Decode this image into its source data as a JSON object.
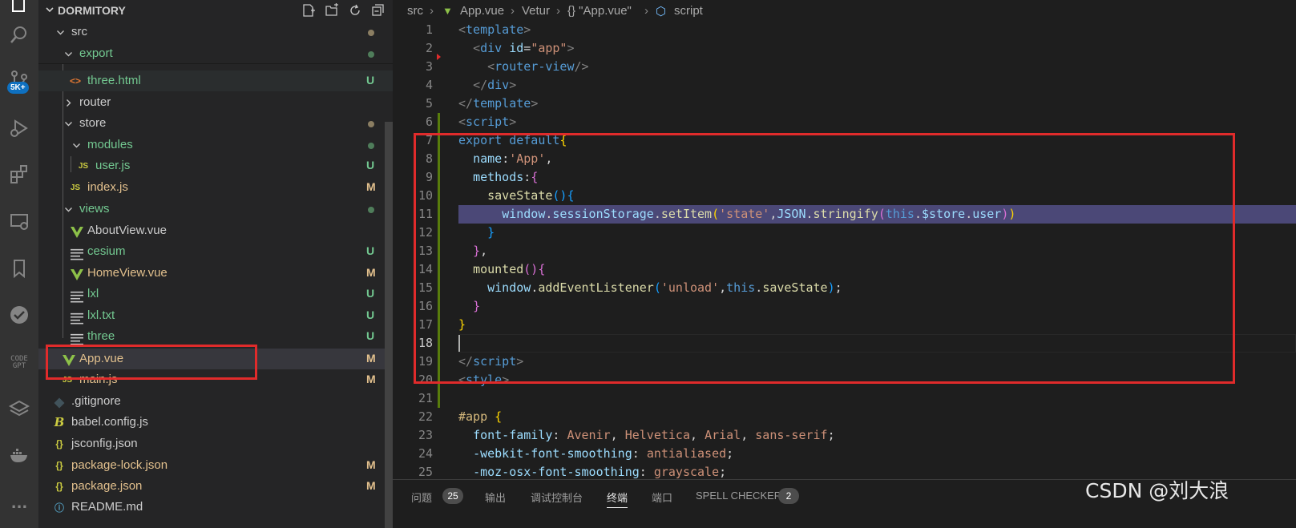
{
  "activity_bar": {
    "icons": [
      "explorer-icon",
      "search-icon",
      "source-control-icon",
      "run-debug-icon",
      "extensions-icon",
      "remote-explorer-icon",
      "bookmarks-icon",
      "testing-icon",
      "codegpt-icon",
      "layers-icon",
      "docker-icon",
      "more-icon"
    ],
    "scm_badge": "5K+",
    "codegpt_label_1": "CODE",
    "codegpt_label_2": "GPT",
    "more_label": "..."
  },
  "explorer": {
    "title": "DORMITORY",
    "actions": [
      "new-file-icon",
      "new-folder-icon",
      "refresh-icon",
      "collapse-icon"
    ],
    "items": [
      {
        "name": "src",
        "type": "folder",
        "status": "",
        "color": "#cccccc"
      },
      {
        "name": "export",
        "type": "folder",
        "status": "",
        "color": "#73c991"
      },
      {
        "name": "three.html",
        "type": "html",
        "status": "U",
        "color": "#73c991"
      },
      {
        "name": "router",
        "type": "folder",
        "status": "",
        "color": "#cccccc"
      },
      {
        "name": "store",
        "type": "folder",
        "status": "",
        "color": "#cccccc"
      },
      {
        "name": "modules",
        "type": "folder",
        "status": "",
        "color": "#73c991"
      },
      {
        "name": "user.js",
        "type": "js",
        "status": "U",
        "color": "#73c991"
      },
      {
        "name": "index.js",
        "type": "js",
        "status": "M",
        "color": "#e2c08d"
      },
      {
        "name": "views",
        "type": "folder",
        "status": "",
        "color": "#73c991"
      },
      {
        "name": "AboutView.vue",
        "type": "vue",
        "status": "",
        "color": "#cccccc"
      },
      {
        "name": "cesium",
        "type": "text",
        "status": "U",
        "color": "#73c991"
      },
      {
        "name": "HomeView.vue",
        "type": "vue",
        "status": "M",
        "color": "#e2c08d"
      },
      {
        "name": "lxl",
        "type": "text",
        "status": "U",
        "color": "#73c991"
      },
      {
        "name": "lxl.txt",
        "type": "text",
        "status": "U",
        "color": "#73c991"
      },
      {
        "name": "three",
        "type": "text",
        "status": "U",
        "color": "#73c991"
      },
      {
        "name": "App.vue",
        "type": "vue",
        "status": "M",
        "color": "#e2c08d"
      },
      {
        "name": "main.js",
        "type": "js",
        "status": "M",
        "color": "#e2c08d"
      },
      {
        "name": ".gitignore",
        "type": "git",
        "status": "",
        "color": "#cccccc"
      },
      {
        "name": "babel.config.js",
        "type": "babel",
        "status": "",
        "color": "#cccccc"
      },
      {
        "name": "jsconfig.json",
        "type": "json",
        "status": "",
        "color": "#cccccc"
      },
      {
        "name": "package-lock.json",
        "type": "json",
        "status": "M",
        "color": "#e2c08d"
      },
      {
        "name": "package.json",
        "type": "json",
        "status": "M",
        "color": "#e2c08d"
      },
      {
        "name": "README.md",
        "type": "info",
        "status": "",
        "color": "#cccccc"
      }
    ]
  },
  "breadcrumb": {
    "parts": [
      "src",
      "App.vue",
      "Vetur",
      "{} \"App.vue\"",
      "script"
    ]
  },
  "editor": {
    "line_numbers": [
      "1",
      "2",
      "3",
      "4",
      "5",
      "6",
      "7",
      "8",
      "9",
      "10",
      "11",
      "12",
      "13",
      "14",
      "15",
      "16",
      "17",
      "18",
      "19",
      "20",
      "21",
      "22",
      "23",
      "24",
      "25"
    ],
    "lines": [
      [
        [
          "t-brk",
          "<"
        ],
        [
          "t-tag",
          "template"
        ],
        [
          "t-brk",
          ">"
        ]
      ],
      [
        [
          "t-pl",
          "  "
        ],
        [
          "t-brk",
          "<"
        ],
        [
          "t-tag",
          "div"
        ],
        [
          "t-pl",
          " "
        ],
        [
          "t-attr",
          "id"
        ],
        [
          "t-pl",
          "="
        ],
        [
          "t-str",
          "\"app\""
        ],
        [
          "t-brk",
          ">"
        ]
      ],
      [
        [
          "t-pl",
          "    "
        ],
        [
          "t-brk",
          "<"
        ],
        [
          "t-tag",
          "router-view"
        ],
        [
          "t-brk",
          "/>"
        ]
      ],
      [
        [
          "t-pl",
          "  "
        ],
        [
          "t-brk",
          "</"
        ],
        [
          "t-tag",
          "div"
        ],
        [
          "t-brk",
          ">"
        ]
      ],
      [
        [
          "t-brk",
          "</"
        ],
        [
          "t-tag",
          "template"
        ],
        [
          "t-brk",
          ">"
        ]
      ],
      [
        [
          "t-brk",
          "<"
        ],
        [
          "t-tag",
          "script"
        ],
        [
          "t-brk",
          ">"
        ]
      ],
      [
        [
          "t-kw",
          "export"
        ],
        [
          "t-pl",
          " "
        ],
        [
          "t-kw",
          "default"
        ],
        [
          "t-b1",
          "{"
        ]
      ],
      [
        [
          "t-pl",
          "  "
        ],
        [
          "t-var",
          "name"
        ],
        [
          "t-pl",
          ":"
        ],
        [
          "t-str",
          "'App'"
        ],
        [
          "t-pl",
          ","
        ]
      ],
      [
        [
          "t-pl",
          "  "
        ],
        [
          "t-var",
          "methods"
        ],
        [
          "t-pl",
          ":"
        ],
        [
          "t-b2",
          "{"
        ]
      ],
      [
        [
          "t-pl",
          "    "
        ],
        [
          "t-fn",
          "saveState"
        ],
        [
          "t-b3",
          "(){"
        ]
      ],
      [
        [
          "t-pl",
          "      "
        ],
        [
          "t-var",
          "window"
        ],
        [
          "t-pl",
          "."
        ],
        [
          "t-var",
          "sessionStorage"
        ],
        [
          "t-pl",
          "."
        ],
        [
          "t-fn",
          "setItem"
        ],
        [
          "t-b1",
          "("
        ],
        [
          "t-str",
          "'state'"
        ],
        [
          "t-pl",
          ","
        ],
        [
          "t-var",
          "JSON"
        ],
        [
          "t-pl",
          "."
        ],
        [
          "t-fn",
          "stringify"
        ],
        [
          "t-b2",
          "("
        ],
        [
          "t-kw",
          "this"
        ],
        [
          "t-pl",
          "."
        ],
        [
          "t-var",
          "$store"
        ],
        [
          "t-pl",
          "."
        ],
        [
          "t-var",
          "user"
        ],
        [
          "t-b2",
          ")"
        ],
        [
          "t-b1",
          ")"
        ]
      ],
      [
        [
          "t-pl",
          "    "
        ],
        [
          "t-b3",
          "}"
        ]
      ],
      [
        [
          "t-pl",
          "  "
        ],
        [
          "t-b2",
          "}"
        ],
        [
          "t-pl",
          ","
        ]
      ],
      [
        [
          "t-pl",
          "  "
        ],
        [
          "t-fn",
          "mounted"
        ],
        [
          "t-b2",
          "(){"
        ]
      ],
      [
        [
          "t-pl",
          "    "
        ],
        [
          "t-var",
          "window"
        ],
        [
          "t-pl",
          "."
        ],
        [
          "t-fn",
          "addEventListener"
        ],
        [
          "t-b3",
          "("
        ],
        [
          "t-str",
          "'unload'"
        ],
        [
          "t-pl",
          ","
        ],
        [
          "t-kw",
          "this"
        ],
        [
          "t-pl",
          "."
        ],
        [
          "t-fn",
          "saveState"
        ],
        [
          "t-b3",
          ")"
        ],
        [
          "t-pl",
          ";"
        ]
      ],
      [
        [
          "t-pl",
          "  "
        ],
        [
          "t-b2",
          "}"
        ]
      ],
      [
        [
          "t-b1",
          "}"
        ]
      ],
      [
        [
          "t-pl",
          ""
        ]
      ],
      [
        [
          "t-brk",
          "</"
        ],
        [
          "t-tag",
          "script"
        ],
        [
          "t-brk",
          ">"
        ]
      ],
      [
        [
          "t-brk",
          "<"
        ],
        [
          "t-tag",
          "style"
        ],
        [
          "t-brk",
          ">"
        ]
      ],
      [
        [
          "t-pl",
          ""
        ]
      ],
      [
        [
          "t-sel",
          "#app"
        ],
        [
          "t-pl",
          " "
        ],
        [
          "t-b1",
          "{"
        ]
      ],
      [
        [
          "t-pl",
          "  "
        ],
        [
          "t-prop",
          "font-family"
        ],
        [
          "t-pl",
          ": "
        ],
        [
          "t-val",
          "Avenir"
        ],
        [
          "t-pl",
          ", "
        ],
        [
          "t-val",
          "Helvetica"
        ],
        [
          "t-pl",
          ", "
        ],
        [
          "t-val",
          "Arial"
        ],
        [
          "t-pl",
          ", "
        ],
        [
          "t-val",
          "sans-serif"
        ],
        [
          "t-pl",
          ";"
        ]
      ],
      [
        [
          "t-pl",
          "  "
        ],
        [
          "t-prop",
          "-webkit-font-smoothing"
        ],
        [
          "t-pl",
          ": "
        ],
        [
          "t-val",
          "antialiased"
        ],
        [
          "t-pl",
          ";"
        ]
      ],
      [
        [
          "t-pl",
          "  "
        ],
        [
          "t-prop",
          "-moz-osx-font-smoothing"
        ],
        [
          "t-pl",
          ": "
        ],
        [
          "t-val",
          "grayscale"
        ],
        [
          "t-pl",
          ";"
        ]
      ]
    ]
  },
  "panel": {
    "tabs": [
      {
        "label": "问题",
        "count": "25"
      },
      {
        "label": "输出",
        "count": ""
      },
      {
        "label": "调试控制台",
        "count": ""
      },
      {
        "label": "终端",
        "count": ""
      },
      {
        "label": "端口",
        "count": ""
      },
      {
        "label": "SPELL CHECKER",
        "count": "2"
      }
    ],
    "active_tab": "终端"
  },
  "watermark": "CSDN @刘大浪",
  "colors": {
    "annotation_red": "#e02b2b",
    "highlight_line": "#4b4877",
    "git_untracked": "#73c991",
    "git_modified": "#e2c08d"
  }
}
